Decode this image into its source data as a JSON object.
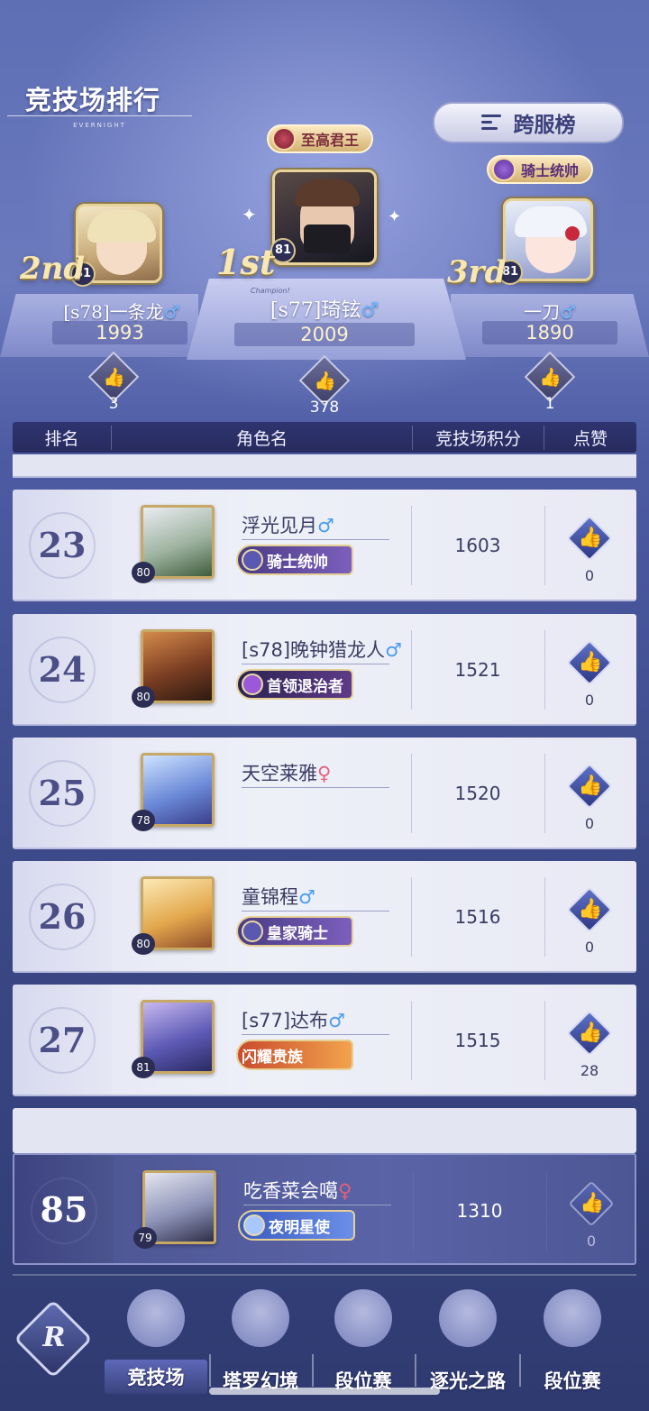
{
  "header": {
    "title": "竞技场排行",
    "subtitle": "EVERNIGHT",
    "cross_server_label": "跨服榜"
  },
  "podium": [
    {
      "place": "1st",
      "server_name": "[s77]琦铉",
      "gender": "♂",
      "score": "2009",
      "level": "81",
      "title_badge": "至高君王",
      "likes": "378",
      "stage_label": "Champion!"
    },
    {
      "place": "2nd",
      "server_name": "[s78]一条龙",
      "gender": "♂",
      "score": "1993",
      "level": "81",
      "likes": "3"
    },
    {
      "place": "3rd",
      "server_name": "一刀",
      "gender": "♂",
      "score": "1890",
      "level": "81",
      "title_badge": "骑士统帅",
      "likes": "1"
    }
  ],
  "table": {
    "columns": [
      "排名",
      "角色名",
      "竞技场积分",
      "点赞"
    ],
    "rows": [
      {
        "rank": "23",
        "name": "浮光见月",
        "gender": "♂",
        "gender_type": "m",
        "level": "80",
        "badge": "骑士统帅",
        "badge_style": "purple",
        "score": "1603",
        "likes": "0"
      },
      {
        "rank": "24",
        "name": "[s78]晚钟猎龙人",
        "gender": "♂",
        "gender_type": "m",
        "level": "80",
        "badge": "首领退治者",
        "badge_style": "dark",
        "score": "1521",
        "likes": "0"
      },
      {
        "rank": "25",
        "name": "天空莱雅",
        "gender": "♀",
        "gender_type": "f",
        "level": "78",
        "badge": "",
        "badge_style": "",
        "score": "1520",
        "likes": "0"
      },
      {
        "rank": "26",
        "name": "童锦程",
        "gender": "♂",
        "gender_type": "m",
        "level": "80",
        "badge": "皇家骑士",
        "badge_style": "purple",
        "score": "1516",
        "likes": "0"
      },
      {
        "rank": "27",
        "name": "[s77]达布",
        "gender": "♂",
        "gender_type": "m",
        "level": "81",
        "badge": "闪耀贵族",
        "badge_style": "orange",
        "score": "1515",
        "likes": "28"
      }
    ],
    "self_row": {
      "rank": "85",
      "name": "吃香菜会噶",
      "gender": "♀",
      "gender_type": "f",
      "level": "79",
      "badge": "夜明星使",
      "badge_style": "blue",
      "score": "1310",
      "likes": "0"
    }
  },
  "nav": {
    "logo_letter": "R",
    "items": [
      {
        "label": "竞技场",
        "active": true
      },
      {
        "label": "塔罗幻境",
        "active": false
      },
      {
        "label": "段位赛",
        "active": false
      },
      {
        "label": "逐光之路",
        "active": false
      },
      {
        "label": "段位赛",
        "active": false
      }
    ]
  },
  "colors": {
    "accent_gold": "#e8d39b",
    "male": "#4b9cf0",
    "female": "#e4607e",
    "header_bar": "#2f3470"
  }
}
